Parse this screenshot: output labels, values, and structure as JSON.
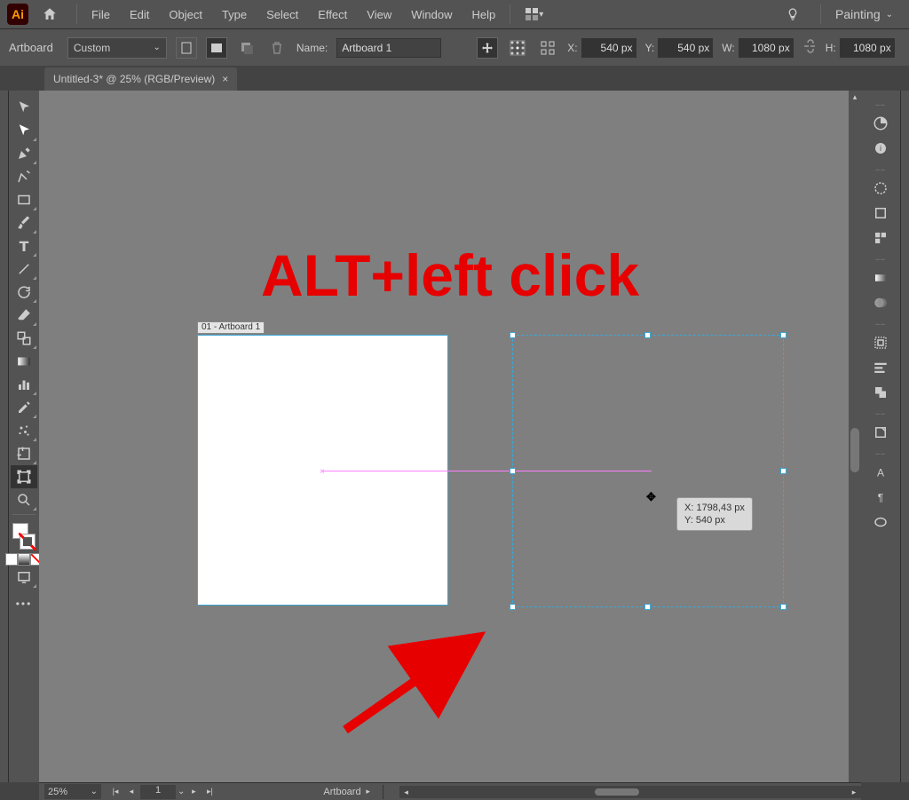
{
  "app": {
    "logo": "Ai"
  },
  "menu": {
    "items": [
      "File",
      "Edit",
      "Object",
      "Type",
      "Select",
      "Effect",
      "View",
      "Window",
      "Help"
    ],
    "workspace": "Painting"
  },
  "control": {
    "label": "Artboard",
    "preset": "Custom",
    "name_label": "Name:",
    "name_value": "Artboard 1",
    "x_label": "X:",
    "x_value": "540 px",
    "y_label": "Y:",
    "y_value": "540 px",
    "w_label": "W:",
    "w_value": "1080 px",
    "h_label": "H:",
    "h_value": "1080 px"
  },
  "tab": {
    "title": "Untitled-3* @ 25% (RGB/Preview)"
  },
  "artboard": {
    "label": "01 - Artboard 1"
  },
  "tooltip": {
    "line1": "X: 1798,43 px",
    "line2": "Y: 540 px"
  },
  "annotation": {
    "text": "ALT+left click"
  },
  "status": {
    "zoom": "25%",
    "artboard_num": "1",
    "label": "Artboard"
  }
}
